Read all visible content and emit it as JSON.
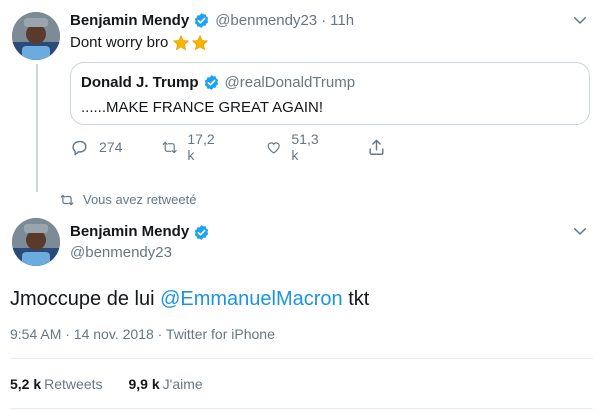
{
  "tweet": {
    "author_name": "Benjamin Mendy",
    "author_handle": "@benmendy23",
    "separator": "·",
    "time": "11h",
    "text": "Dont worry bro",
    "emoji": [
      "star-emoji",
      "star-emoji"
    ],
    "quoted": {
      "author_name": "Donald J. Trump",
      "author_handle": "@realDonaldTrump",
      "text": "......MAKE FRANCE GREAT AGAIN!"
    },
    "replies": "274",
    "retweets": "17,2 k",
    "likes": "51,3 k"
  },
  "retweet_notice": "Vous avez retweeté",
  "main_tweet": {
    "author_name": "Benjamin Mendy",
    "author_handle": "@benmendy23",
    "text_before": "Jmoccupe de lui ",
    "mention": "@EmmanuelMacron",
    "text_after": " tkt",
    "meta": "9:54 AM · 14 nov. 2018 · Twitter for iPhone",
    "retweets_count": "5,2 k",
    "retweets_label": "Retweets",
    "likes_count": "9,9 k",
    "likes_label": "J'aime"
  },
  "colors": {
    "verified": "#1da1f2",
    "link": "#1b95e0",
    "secondary_text": "#657786",
    "border": "#ccd6dd"
  }
}
